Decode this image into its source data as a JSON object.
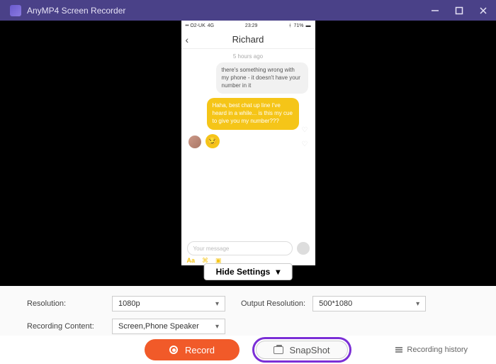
{
  "titlebar": {
    "title": "AnyMP4 Screen Recorder"
  },
  "phone": {
    "statusbar": {
      "carrier": "•• O2-UK",
      "net": "4G",
      "time": "23:29",
      "battery": "71%"
    },
    "header_name": "Richard",
    "timestamp": "5 hours ago",
    "msg_in": "there's something wrong with my phone - it doesn't have your number in it",
    "msg_out": "Haha, best chat up line I've heard in a while... is this my cue to give you my number???",
    "input_placeholder": "Your message",
    "toolbar": {
      "aa": "Aa"
    }
  },
  "hide_settings": "Hide Settings",
  "settings": {
    "resolution_label": "Resolution:",
    "resolution_value": "1080p",
    "output_label": "Output Resolution:",
    "output_value": "500*1080",
    "content_label": "Recording Content:",
    "content_value": "Screen,Phone Speaker"
  },
  "buttons": {
    "record": "Record",
    "snapshot": "SnapShot",
    "history": "Recording history"
  }
}
